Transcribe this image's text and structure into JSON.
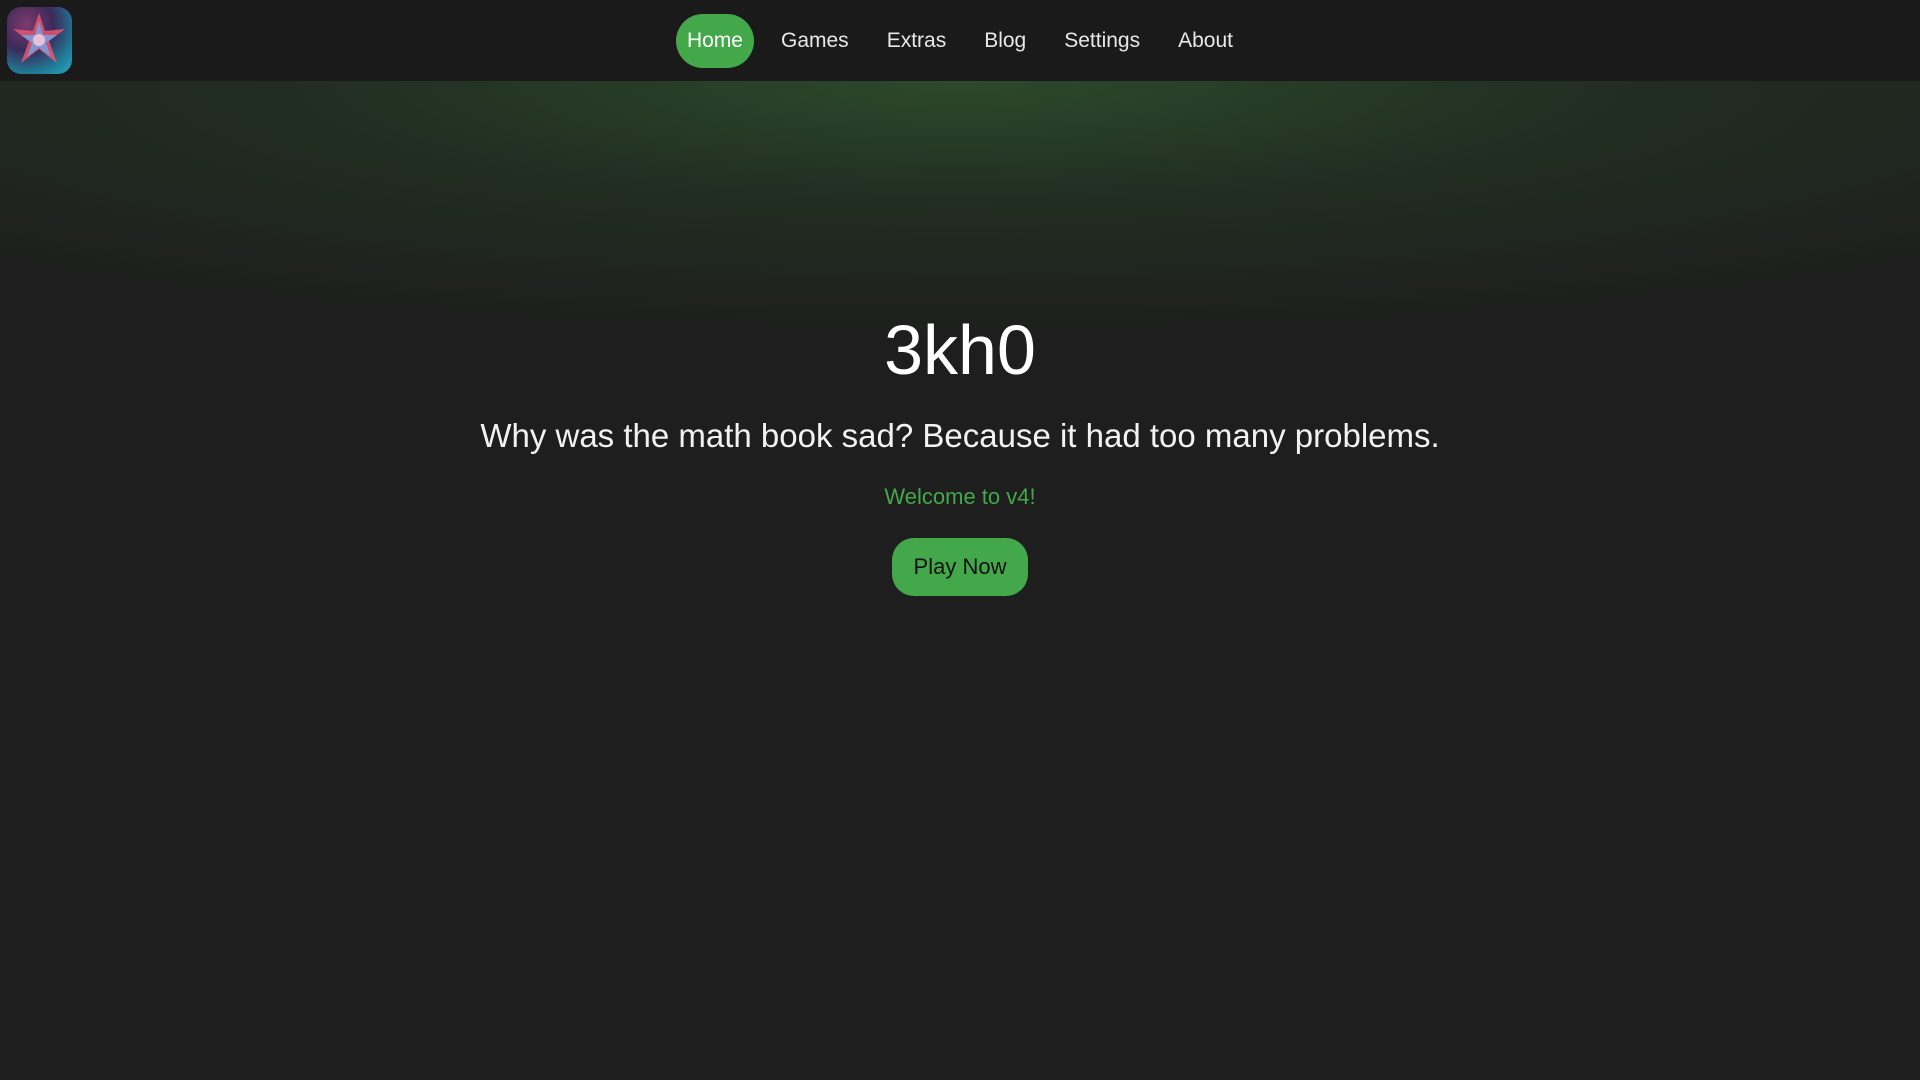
{
  "header": {
    "logo_icon": "3kh0-logo-icon",
    "nav": [
      {
        "label": "Home",
        "active": true
      },
      {
        "label": "Games",
        "active": false
      },
      {
        "label": "Extras",
        "active": false
      },
      {
        "label": "Blog",
        "active": false
      },
      {
        "label": "Settings",
        "active": false
      },
      {
        "label": "About",
        "active": false
      }
    ]
  },
  "hero": {
    "title": "3kh0",
    "subtitle": "Why was the math book sad? Because it had too many problems.",
    "welcome": "Welcome to v4!",
    "play_label": "Play Now"
  },
  "colors": {
    "accent": "#43a84a",
    "background": "#1e1e1e",
    "topbar": "#1a1a1a"
  }
}
